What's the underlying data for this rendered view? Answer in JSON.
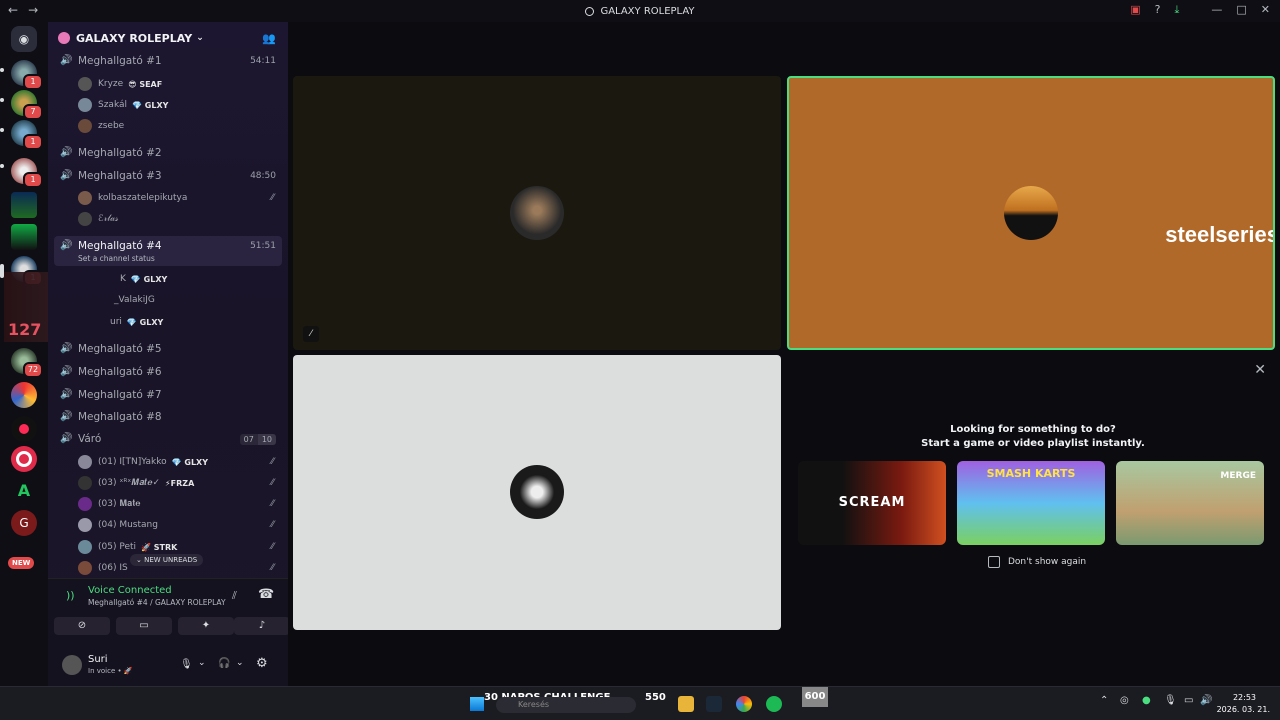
{
  "app": {
    "window_title": "GALAXY ROLEPLAY"
  },
  "guilds": {
    "badges": [
      "1",
      "7",
      "1",
      "1",
      "1",
      "72"
    ],
    "counter_overlay": "127",
    "new_label": "NEW"
  },
  "server": {
    "name": "GALAXY ROLEPLAY"
  },
  "channels": {
    "ch1": {
      "name": "Meghallgató #1",
      "timer": "54:11"
    },
    "ch1_members": [
      {
        "name": "Kryze",
        "tag": "😎 SEAF"
      },
      {
        "name": "Szakál",
        "tag": "💎 GLXY"
      },
      {
        "name": "zsebe",
        "tag": ""
      }
    ],
    "ch2": {
      "name": "Meghallgató #2"
    },
    "ch3": {
      "name": "Meghallgató #3",
      "timer": "48:50"
    },
    "ch3_members": [
      {
        "name": "kolbaszatelepikutya"
      },
      {
        "name": "ℰ𝓇𝓁𝒶𝓈"
      }
    ],
    "ch4": {
      "name": "Meghallgató #4",
      "timer": "51:51",
      "status": "Set a channel status"
    },
    "ch4_members": [
      {
        "name": "K",
        "tag": "💎 GLXY"
      },
      {
        "name": "_ValakiJG",
        "tag": ""
      },
      {
        "name": "uri",
        "tag": "💎 GLXY"
      }
    ],
    "ch5": {
      "name": "Meghallgató #5"
    },
    "ch6": {
      "name": "Meghallgató #6"
    },
    "ch7": {
      "name": "Meghallgató #7"
    },
    "ch8": {
      "name": "Meghallgató #8"
    },
    "waiting": {
      "name": "Váró",
      "count_a": "07",
      "count_b": "10"
    },
    "waiting_members": [
      {
        "name": "(01) I[TN]Yakko",
        "tag": "💎 GLXY"
      },
      {
        "name": "(03) ˣᴿˣ𝑴𝒂𝒕𝒆✓",
        "tag": "⚡FRZA"
      },
      {
        "name": "(03) 𝐌𝐚𝐭𝐞",
        "tag": ""
      },
      {
        "name": "(04) Mustang",
        "tag": ""
      },
      {
        "name": "(05) Peti",
        "tag": "🚀 STRK"
      },
      {
        "name": "(06) IS",
        "tag": ""
      }
    ],
    "new_unreads": "NEW UNREADS"
  },
  "voice": {
    "title": "Voice Connected",
    "subtitle": "Meghallgató #4 / GALAXY ROLEPLAY"
  },
  "user": {
    "name": "Suri",
    "status": "In voice • 🚀"
  },
  "stage": {
    "brand_text": "steelseries",
    "activity_line1": "Looking for something to do?",
    "activity_line2": "Start a game or video playlist instantly.",
    "cards": [
      {
        "title": "SCREAM"
      },
      {
        "title": "SMASH KARTS"
      },
      {
        "title": "MERGE"
      }
    ],
    "dont_show": "Don't show again"
  },
  "taskbar": {
    "challenge": "30 NAPOS CHALLENGE",
    "search_placeholder": "Keresés",
    "num_a": "550",
    "num_b": "600",
    "time": "22:53",
    "date": "2026. 03. 21."
  },
  "colors": {
    "accent_green": "#4ade80",
    "tile_orange": "#b1692a",
    "tile_dark": "#1b1810",
    "tile_light": "#dcdedd"
  }
}
